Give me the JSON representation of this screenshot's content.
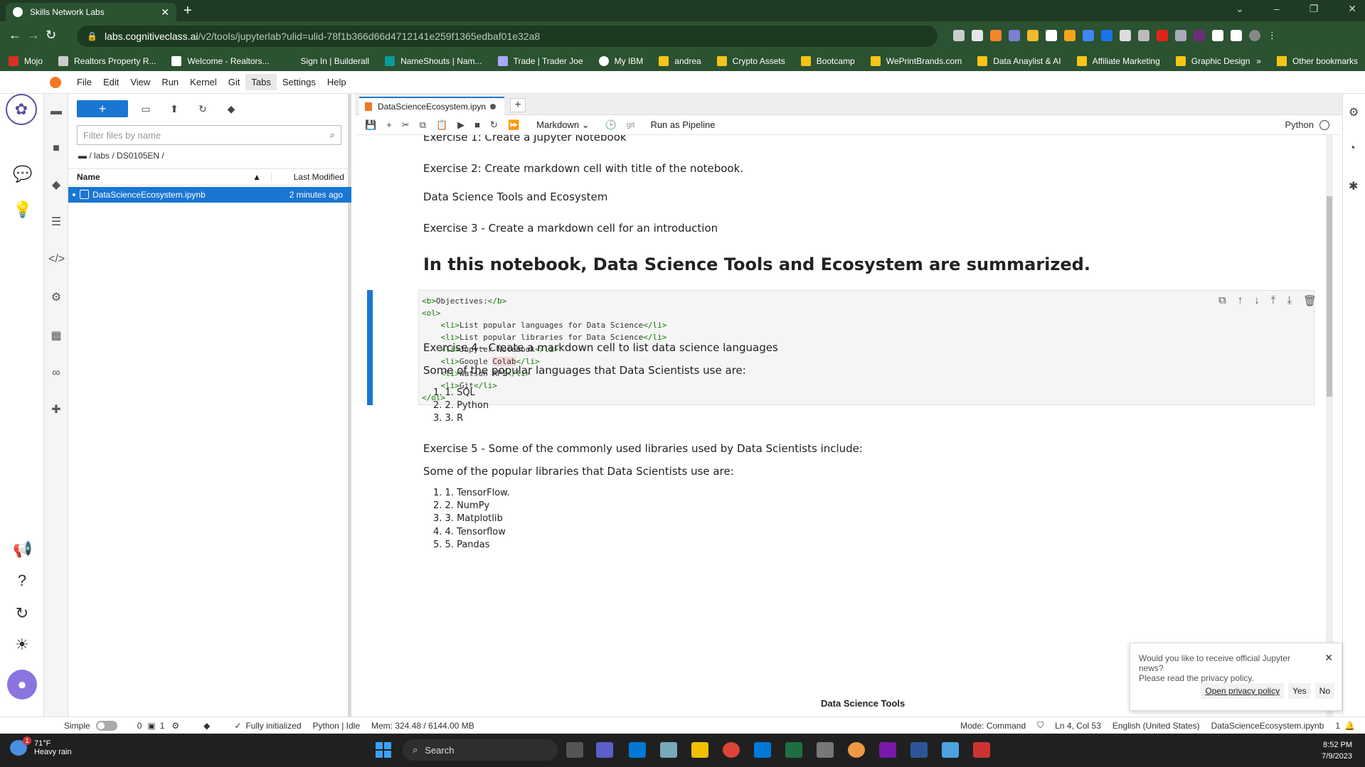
{
  "browser": {
    "tab_title": "Skills Network Labs",
    "url_host": "labs.cognitiveclass.ai",
    "url_path": "/v2/tools/jupyterlab?ulid=ulid-78f1b366d66d4712141e259f1365edbaf01e32a8",
    "bookmarks": [
      "Mojo",
      "Realtors Property R...",
      "Welcome - Realtors...",
      "Sign In | Builderall",
      "NameShouts | Nam...",
      "Trade | Trader Joe",
      "My IBM",
      "andrea",
      "Crypto Assets",
      "Bootcamp",
      "WePrintBrands.com",
      "Data Anaylist & AI",
      "Affiliate Marketing",
      "Graphic Design"
    ],
    "bookmarks_more": "»",
    "other_bookmarks": "Other bookmarks"
  },
  "menu": [
    "File",
    "Edit",
    "View",
    "Run",
    "Kernel",
    "Git",
    "Tabs",
    "Settings",
    "Help"
  ],
  "filebrowser": {
    "filter_placeholder": "Filter files by name",
    "breadcrumb": "/ labs / DS0105EN /",
    "col_name": "Name",
    "col_modified": "Last Modified",
    "file_name": "DataScienceEcosystem.ipynb",
    "file_modified": "2 minutes ago"
  },
  "notebook": {
    "tab_label": "DataScienceEcosystem.ipyn",
    "cell_type": "Markdown",
    "git_label": "git",
    "run_pipeline": "Run as Pipeline",
    "kernel": "Python",
    "ex1": "Exercise 1: Create a Jupyter Notebook",
    "ex2": "Exercise 2: Create markdown cell with title of the notebook.",
    "title_text": "Data Science Tools and Ecosystem",
    "ex3": "Exercise 3 - Create a markdown cell for an introduction",
    "intro_heading": "In this notebook, Data Science Tools and Ecosystem are summarized.",
    "ex4": "Exercise 4 - Create a markdown cell to list data science languages",
    "languages_intro": "Some of the popular languages that Data Scientists use are:",
    "languages": [
      "1. 1. SQL",
      "2. 2. Python",
      "3. 3. R"
    ],
    "ex5": "Exercise 5 - Some of the commonly used libraries used by Data Scientists include:",
    "libraries_intro": "Some of the popular libraries that Data Scientists use are:",
    "libraries": [
      "1. 1. TensorFlow.",
      "2. 2. NumPy",
      "3. 3. Matplotlib",
      "4. 4. Tensorflow",
      "5. 5. Pandas"
    ],
    "tools_heading": "Data Science Tools"
  },
  "notification": {
    "line1": "Would you like to receive official Jupyter news?",
    "line2": "Please read the privacy policy.",
    "policy_link": "Open privacy policy",
    "yes": "Yes",
    "no": "No"
  },
  "statusbar": {
    "simple": "Simple",
    "count_a": "0",
    "count_b": "1",
    "init": "Fully initialized",
    "kernel_state": "Python | Idle",
    "mem": "Mem: 324.48 / 6144.00 MB",
    "mode": "Mode: Command",
    "position": "Ln 4, Col 53",
    "language": "English (United States)",
    "filename": "DataScienceEcosystem.ipynb",
    "notif_count": "1"
  },
  "taskbar": {
    "temp": "71°F",
    "weather": "Heavy rain",
    "weather_badge": "1",
    "search": "Search",
    "time": "8:52 PM",
    "date": "7/9/2023"
  }
}
